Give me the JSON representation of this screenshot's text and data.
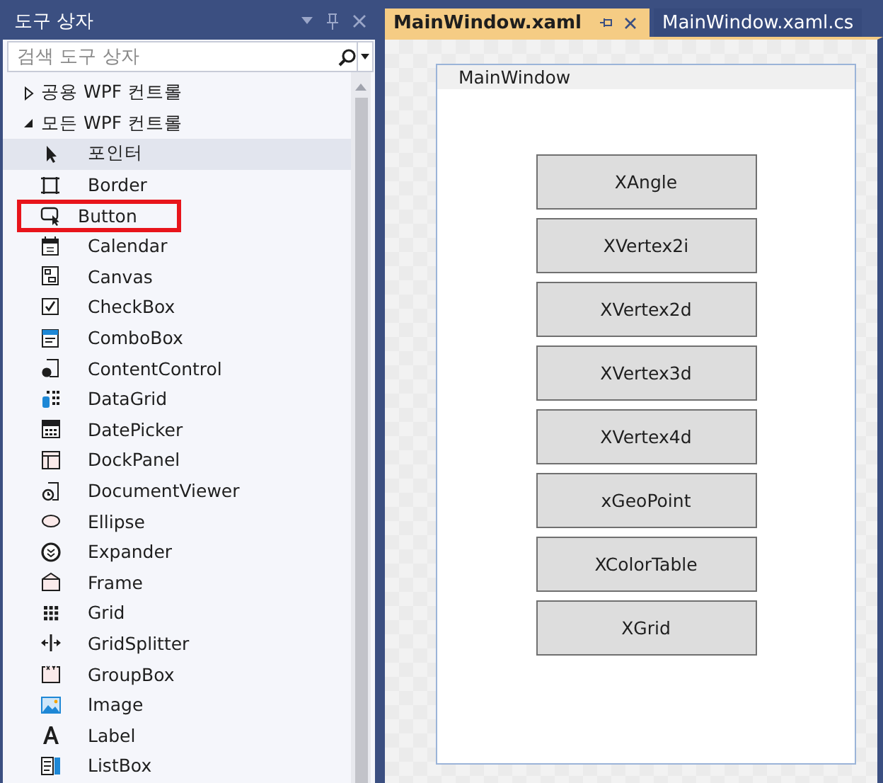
{
  "toolbox": {
    "title": "도구 상자",
    "search": {
      "placeholder": "검색 도구 상자"
    },
    "groups": [
      {
        "label": "공용 WPF 컨트롤",
        "expanded": false
      },
      {
        "label": "모든 WPF 컨트롤",
        "expanded": true,
        "children": [
          {
            "label": "포인터",
            "selected": true,
            "highlighted": false
          },
          {
            "label": "Border",
            "selected": false,
            "highlighted": false
          },
          {
            "label": "Button",
            "selected": false,
            "highlighted": true
          },
          {
            "label": "Calendar",
            "selected": false,
            "highlighted": false
          },
          {
            "label": "Canvas",
            "selected": false,
            "highlighted": false
          },
          {
            "label": "CheckBox",
            "selected": false,
            "highlighted": false
          },
          {
            "label": "ComboBox",
            "selected": false,
            "highlighted": false
          },
          {
            "label": "ContentControl",
            "selected": false,
            "highlighted": false
          },
          {
            "label": "DataGrid",
            "selected": false,
            "highlighted": false
          },
          {
            "label": "DatePicker",
            "selected": false,
            "highlighted": false
          },
          {
            "label": "DockPanel",
            "selected": false,
            "highlighted": false
          },
          {
            "label": "DocumentViewer",
            "selected": false,
            "highlighted": false
          },
          {
            "label": "Ellipse",
            "selected": false,
            "highlighted": false
          },
          {
            "label": "Expander",
            "selected": false,
            "highlighted": false
          },
          {
            "label": "Frame",
            "selected": false,
            "highlighted": false
          },
          {
            "label": "Grid",
            "selected": false,
            "highlighted": false
          },
          {
            "label": "GridSplitter",
            "selected": false,
            "highlighted": false
          },
          {
            "label": "GroupBox",
            "selected": false,
            "highlighted": false
          },
          {
            "label": "Image",
            "selected": false,
            "highlighted": false
          },
          {
            "label": "Label",
            "selected": false,
            "highlighted": false
          },
          {
            "label": "ListBox",
            "selected": false,
            "highlighted": false
          }
        ]
      }
    ]
  },
  "tabs": [
    {
      "label": "MainWindow.xaml",
      "selected": true
    },
    {
      "label": "MainWindow.xaml.cs",
      "selected": false
    }
  ],
  "designer": {
    "window_title": "MainWindow",
    "buttons": [
      "XAngle",
      "XVertex2i",
      "XVertex2d",
      "XVertex3d",
      "XVertex4d",
      "xGeoPoint",
      "XColorTable",
      "XGrid"
    ]
  }
}
